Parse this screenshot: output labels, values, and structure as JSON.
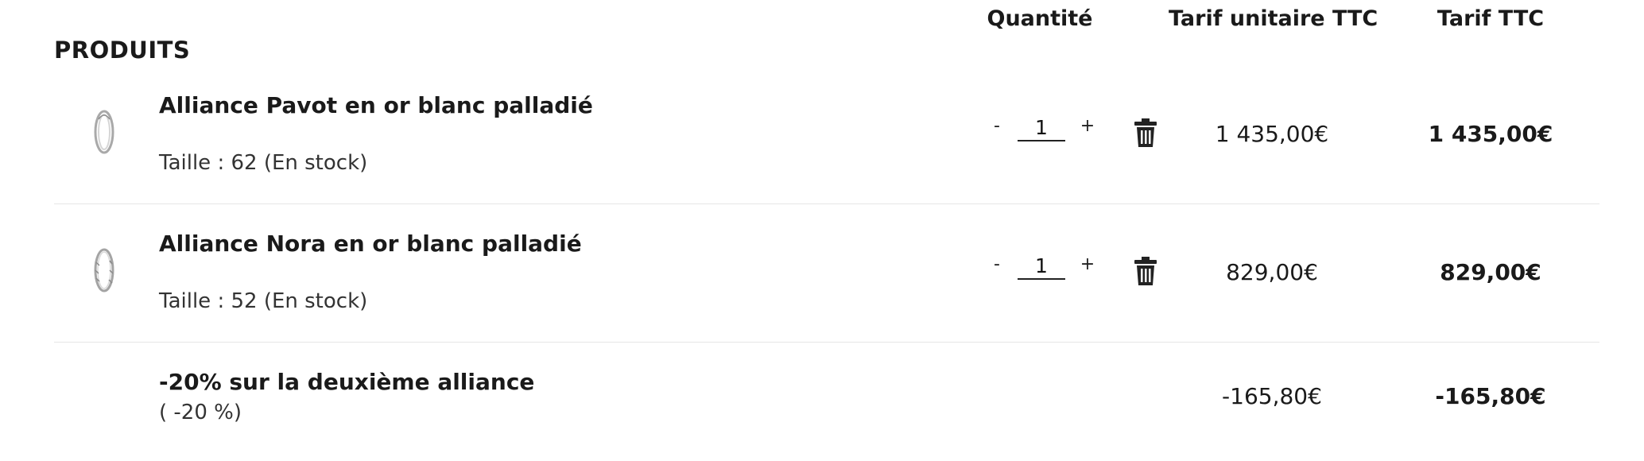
{
  "headers": {
    "quantity": "Quantité",
    "unit_price": "Tarif unitaire TTC",
    "total_price": "Tarif TTC"
  },
  "section_title": "PRODUITS",
  "items": [
    {
      "name": "Alliance Pavot en or blanc palladié",
      "detail": "Taille : 62 (En stock)",
      "quantity": "1",
      "minus": "-",
      "plus": "+",
      "unit_price": "1 435,00€",
      "total": "1 435,00€",
      "thumbnail_icon": "ring-icon",
      "delete_icon": "trash-icon"
    },
    {
      "name": "Alliance Nora en or blanc palladié",
      "detail": "Taille : 52 (En stock)",
      "quantity": "1",
      "minus": "-",
      "plus": "+",
      "unit_price": "829,00€",
      "total": "829,00€",
      "thumbnail_icon": "twisted-ring-icon",
      "delete_icon": "trash-icon"
    }
  ],
  "discount": {
    "label": "-20% sur la deuxième alliance",
    "detail": "( -20 %)",
    "unit_price": "-165,80€",
    "total": "-165,80€"
  }
}
